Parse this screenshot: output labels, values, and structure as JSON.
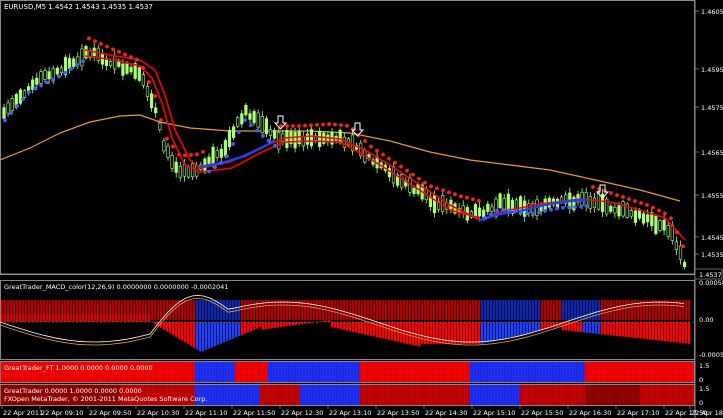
{
  "main_chart": {
    "header": "EURUSD,M5  1.4542 1.4543 1.4535 1.4537",
    "current_price_label": "1.4537",
    "price_ticks": [
      "1.4605",
      "1.4595",
      "1.4575",
      "1.4565",
      "1.4555",
      "1.4545",
      "1.4535"
    ]
  },
  "indicators": [
    {
      "label": "GreatTrader_MACD_color(12,26,9) 0.0000000 0.0000000 -0.0002041",
      "scale": [
        "0.00058",
        "0.00",
        "-0.00053"
      ]
    },
    {
      "label": "GreatTrader_FT 1.0000 0.0000 0.0000 0.0000",
      "scale": [
        "1.5",
        "0"
      ]
    },
    {
      "label": "GreatTrader 0.0000 1.0000 0.0000 0.0000",
      "scale": [
        "1.5",
        "0"
      ]
    }
  ],
  "copyright": "FXOpen MetaTrader, © 2001-2011 MetaQuotes Software Corp.",
  "time_axis": [
    "22 Apr 2011",
    "22 Apr 09:10",
    "22 Apr 09:50",
    "22 Apr 10:30",
    "22 Apr 11:10",
    "22 Apr 11:50",
    "22 Apr 12:30",
    "22 Apr 13:10",
    "22 Apr 13:50",
    "22 Apr 14:30",
    "22 Apr 15:10",
    "22 Apr 15:50",
    "22 Apr 16:30",
    "22 Apr 17:10",
    "22 Apr 17:50",
    "22 Apr 18:30"
  ],
  "colors": {
    "background": "#000000",
    "grid": "#ffffff",
    "bull_candle": "#aaff77",
    "bear_red": "#ff0000",
    "blue": "#2040ff",
    "orange_ma": "#e69b2e"
  }
}
